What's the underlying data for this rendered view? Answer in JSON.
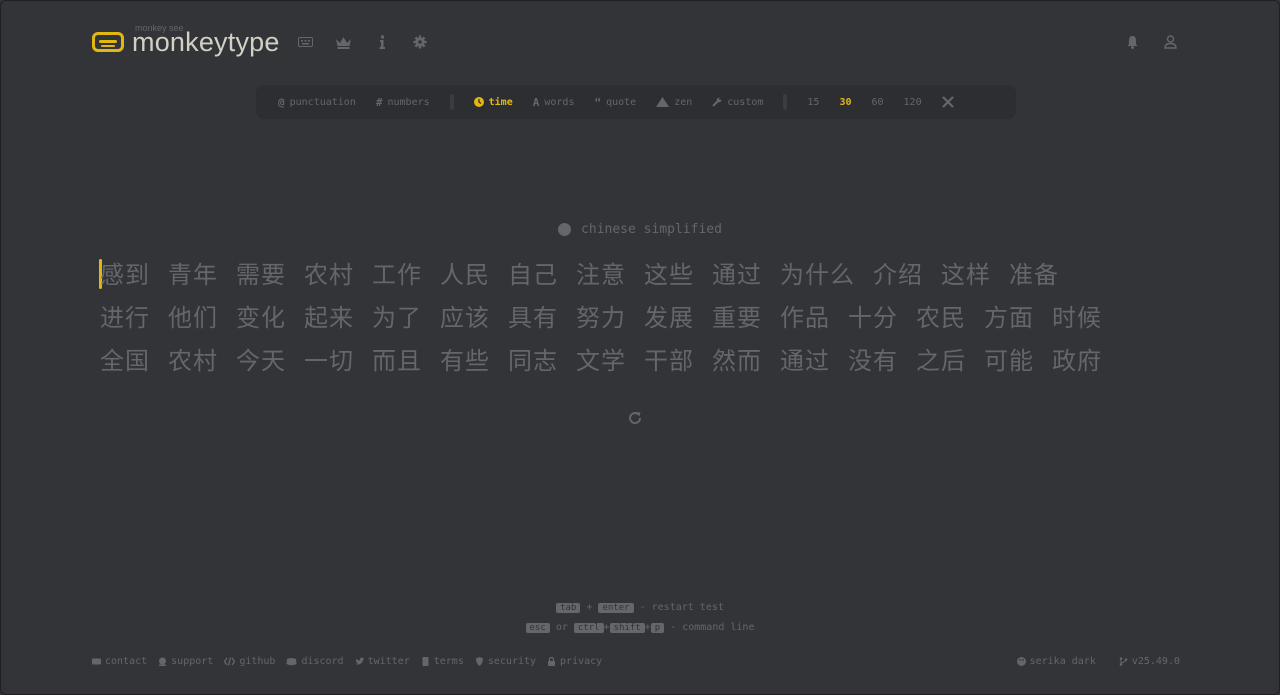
{
  "header": {
    "logo_top": "monkey see",
    "logo_text": "monkeytype",
    "nav_icons": [
      "keyboard-icon",
      "crown-icon",
      "info-icon",
      "gear-icon"
    ],
    "right_icons": [
      "bell-icon",
      "user-icon"
    ]
  },
  "config": {
    "punctuation": "punctuation",
    "numbers": "numbers",
    "time": "time",
    "words": "words",
    "quote": "quote",
    "zen": "zen",
    "custom": "custom",
    "durations": [
      "15",
      "30",
      "60",
      "120"
    ],
    "selected_duration": "30",
    "active_mode": "time"
  },
  "language": "chinese simplified",
  "words": [
    [
      "感到",
      "青年",
      "需要",
      "农村",
      "工作",
      "人民",
      "自己",
      "注意",
      "这些",
      "通过",
      "为什么",
      "介绍",
      "这样",
      "准备"
    ],
    [
      "进行",
      "他们",
      "变化",
      "起来",
      "为了",
      "应该",
      "具有",
      "努力",
      "发展",
      "重要",
      "作品",
      "十分",
      "农民",
      "方面",
      "时候"
    ],
    [
      "全国",
      "农村",
      "今天",
      "一切",
      "而且",
      "有些",
      "同志",
      "文学",
      "干部",
      "然而",
      "通过",
      "没有",
      "之后",
      "可能",
      "政府"
    ]
  ],
  "hints": {
    "line1": {
      "key1": "tab",
      "plus": "+",
      "key2": "enter",
      "text": "- restart test"
    },
    "line2": {
      "key1": "esc",
      "or": "or",
      "key2": "ctrl",
      "plus1": "+",
      "key3": "shift",
      "plus2": "+",
      "key4": "p",
      "text": "- command line"
    }
  },
  "footer": {
    "links": [
      "contact",
      "support",
      "github",
      "discord",
      "twitter",
      "terms",
      "security",
      "privacy"
    ],
    "theme": "serika dark",
    "version": "v25.49.0"
  },
  "colors": {
    "bg": "#323437",
    "sub": "#646669",
    "main": "#e2b714",
    "text": "#d1d0c5"
  }
}
